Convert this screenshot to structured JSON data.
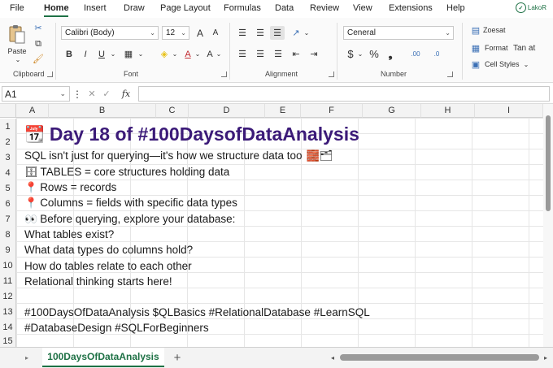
{
  "menu": {
    "tabs": [
      "File",
      "Home",
      "Insert",
      "Draw",
      "Page Layout",
      "Formulas",
      "Data",
      "Review",
      "View",
      "Extensions",
      "Help"
    ],
    "brand": "LakoR"
  },
  "ribbon": {
    "clipboard": {
      "paste_label": "Paste",
      "group_label": "Clipboard"
    },
    "font": {
      "font_name": "Calibri (Body)",
      "font_size": "12",
      "grow_label": "A",
      "shrink_label": "A",
      "bold": "B",
      "italic": "I",
      "underline": "U",
      "group_label": "Font"
    },
    "alignment": {
      "group_label": "Alignment"
    },
    "number": {
      "format": "Ceneral",
      "currency": "$",
      "percent": "%",
      "group_label": "Number"
    },
    "styles": {
      "conditional": "Zoesat",
      "format_as": "Format",
      "format_as_extra": "Tan at",
      "cell_styles": "Cell Styles"
    }
  },
  "formula_bar": {
    "name_box": "A1",
    "fx": "fx",
    "value": ""
  },
  "columns": [
    "A",
    "B",
    "C",
    "D",
    "E",
    "F",
    "G",
    "H",
    "I"
  ],
  "rows": [
    "1",
    "2",
    "3",
    "4",
    "5",
    "6",
    "7",
    "8",
    "9",
    "10",
    "11",
    "12",
    "13",
    "14",
    "15"
  ],
  "content": {
    "title": "Day 18 of #100DaysofDataAnalysis",
    "title_emoji": "📆",
    "line1": "SQL isn't just for querying—it's how we structure data too",
    "line1_emoji": "🧱🗂",
    "line2": "TABLES = core structures holding data",
    "line2_emoji": "🗄",
    "line3": "Rows = records",
    "line3_emoji": "📍",
    "line4": "Columns = fields with specific data types",
    "line4_emoji": "📍",
    "line5": "Before querying, explore your database:",
    "line5_emoji": "👀",
    "line6": "What tables exist?",
    "line7": "What data types do columns hold?",
    "line8": "How do tables relate to each other",
    "line9": "Relational thinking starts here!",
    "line10": "#100DaysOfDataAnalysis $QLBasics #RelationalDatabase #LearnSQL",
    "line11": "#DatabaseDesign #SQLForBeginners"
  },
  "sheet": {
    "tab_name": "100DaysOfDataAnalysis",
    "add_label": "+"
  },
  "colors": {
    "accent": "#1e7145",
    "title": "#3b1a78"
  }
}
